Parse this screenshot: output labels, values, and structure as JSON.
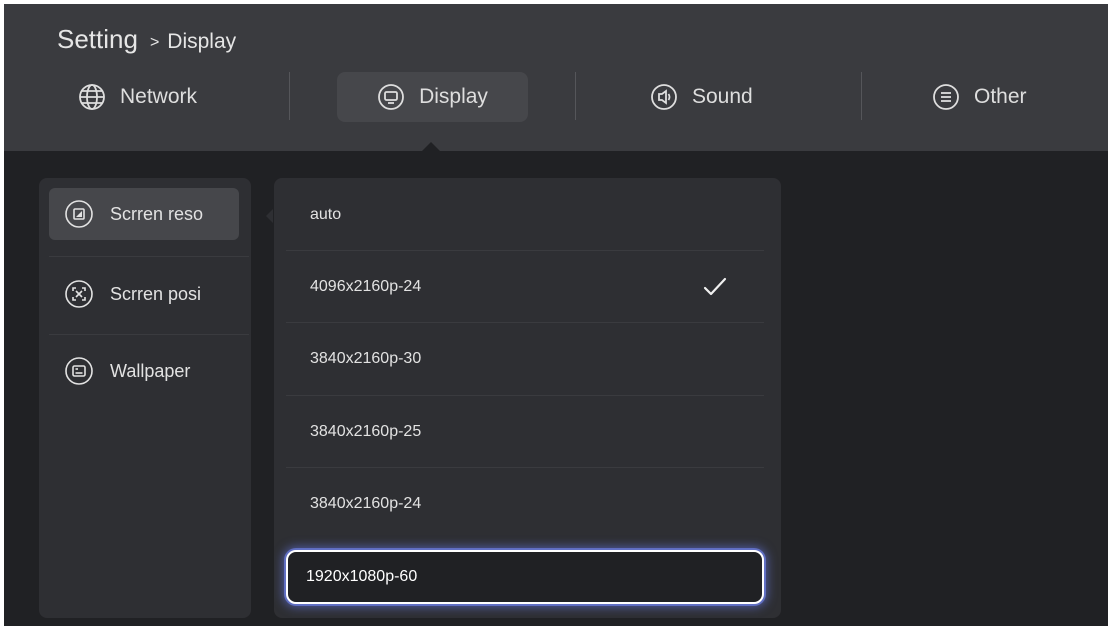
{
  "breadcrumb": {
    "root": "Setting",
    "separator": ">",
    "current": "Display"
  },
  "tabs": [
    {
      "label": "Network",
      "icon": "globe-icon"
    },
    {
      "label": "Display",
      "icon": "monitor-icon",
      "active": true
    },
    {
      "label": "Sound",
      "icon": "speaker-icon"
    },
    {
      "label": "Other",
      "icon": "menu-icon"
    }
  ],
  "sidebar": {
    "items": [
      {
        "label": "Scrren reso",
        "icon": "resolution-icon",
        "active": true
      },
      {
        "label": "Scrren posi",
        "icon": "position-icon"
      },
      {
        "label": "Wallpaper",
        "icon": "wallpaper-icon"
      }
    ]
  },
  "resolution_options": {
    "selected": "4096x2160p-24",
    "focused": "1920x1080p-60",
    "items": [
      "auto",
      "4096x2160p-24",
      "3840x2160p-30",
      "3840x2160p-25",
      "3840x2160p-24",
      "1920x1080p-60"
    ]
  },
  "colors": {
    "background": "#202124",
    "header": "#3a3b3f",
    "panel": "#2e2f33",
    "active_item": "#46474b",
    "focus_glow": "#6e82ff"
  }
}
